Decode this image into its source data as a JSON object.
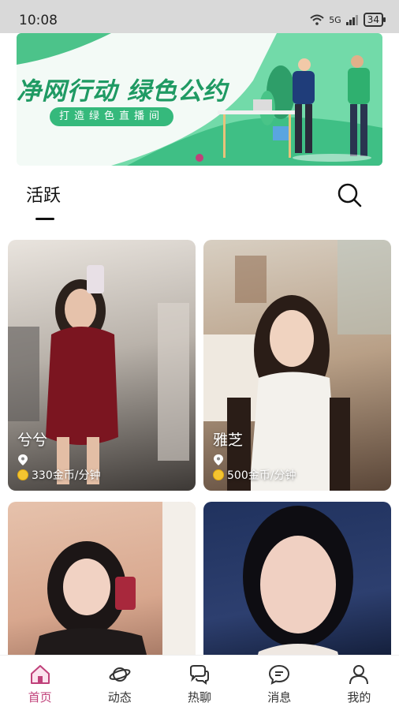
{
  "status_bar": {
    "time": "10:08",
    "network": "5G",
    "battery": "34"
  },
  "banner": {
    "title": "净网行动  绿色公约",
    "subtitle": "打造绿色直播间"
  },
  "tabs": {
    "active": "活跃"
  },
  "cards": [
    {
      "name": "兮兮",
      "price": "330金币/分钟"
    },
    {
      "name": "雅芝",
      "price": "500金币/分钟"
    },
    {
      "name": "",
      "price": ""
    },
    {
      "name": "",
      "price": ""
    }
  ],
  "bottom_nav": [
    {
      "label": "首页",
      "icon": "home-icon",
      "active": true
    },
    {
      "label": "动态",
      "icon": "planet-icon"
    },
    {
      "label": "热聊",
      "icon": "chat-bubbles-icon"
    },
    {
      "label": "消息",
      "icon": "message-icon"
    },
    {
      "label": "我的",
      "icon": "user-icon"
    }
  ],
  "colors": {
    "accent": "#c0417a",
    "banner_green": "#1f9a63"
  }
}
